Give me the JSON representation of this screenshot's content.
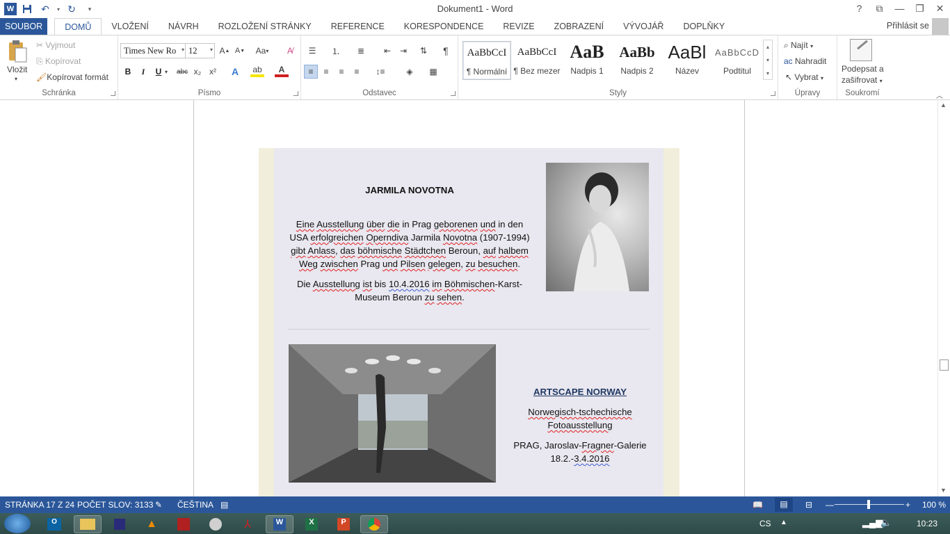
{
  "window": {
    "title": "Dokument1 - Word",
    "help": "?",
    "signin": "Přihlásit se"
  },
  "tabs": [
    "SOUBOR",
    "DOMŮ",
    "VLOŽENÍ",
    "NÁVRH",
    "ROZLOŽENÍ STRÁNKY",
    "REFERENCE",
    "KORESPONDENCE",
    "REVIZE",
    "ZOBRAZENÍ",
    "VÝVOJÁŘ",
    "DOPLŇKY"
  ],
  "ribbon": {
    "clipboard": {
      "paste": "Vložit",
      "cut": "Vyjmout",
      "copy": "Kopírovat",
      "format_painter": "Kopírovat formát",
      "label": "Schránka"
    },
    "font": {
      "name": "Times New Ro",
      "size": "12",
      "change_case": "Aa",
      "bold": "B",
      "italic": "I",
      "underline": "U",
      "strike": "abc",
      "sub": "x₂",
      "sup": "x²",
      "label": "Písmo"
    },
    "paragraph": {
      "label": "Odstavec"
    },
    "styles": {
      "items": [
        {
          "preview": "AaBbCcI",
          "name": "¶ Normální"
        },
        {
          "preview": "AaBbCcI",
          "name": "¶ Bez mezer"
        },
        {
          "preview": "AaB",
          "name": "Nadpis 1"
        },
        {
          "preview": "AaBb",
          "name": "Nadpis 2"
        },
        {
          "preview": "AaBl",
          "name": "Název"
        },
        {
          "preview": "AaBbCcD",
          "name": "Podtitul"
        }
      ],
      "label": "Styly"
    },
    "editing": {
      "find": "Najít",
      "replace": "Nahradit",
      "select": "Vybrat",
      "label": "Úpravy"
    },
    "privacy": {
      "sign": "Podepsat a",
      "encrypt": "zašifrovat",
      "label": "Soukromí"
    }
  },
  "document": {
    "heading1": "JARMILA NOVOTNA",
    "para1_lines": [
      "Eine Ausstellung über die in Prag geborenen und in den",
      "USA erfolgreichen Operndiva Jarmila Novotna (1907-1994)",
      "gibt Anlass, das böhmische Städtchen Beroun, auf halbem",
      "Weg zwischen Prag und Pilsen gelegen, zu besuchen."
    ],
    "para2_lines": [
      "Die Ausstellung ist bis 10.4.2016 im Böhmischen-Karst-",
      "Museum Beroun zu sehen."
    ],
    "heading2": "ARTSCAPE NORWAY",
    "para3_lines": [
      "Norwegisch-tschechische",
      "Fotoausstellung"
    ],
    "para4_lines": [
      "PRAG, Jaroslav-Fragner-Galerie",
      "18.2.-3.4.2016"
    ]
  },
  "status": {
    "page": "STRÁNKA 17 Z 24",
    "words": "POČET SLOV: 3133",
    "language": "ČEŠTINA",
    "zoom": "100 %"
  },
  "taskbar": {
    "lang": "CS",
    "time": "10:23"
  },
  "colors": {
    "accent": "#2b579a",
    "table_outer": "#f2eedc",
    "table_inner": "#e9e7ef"
  }
}
